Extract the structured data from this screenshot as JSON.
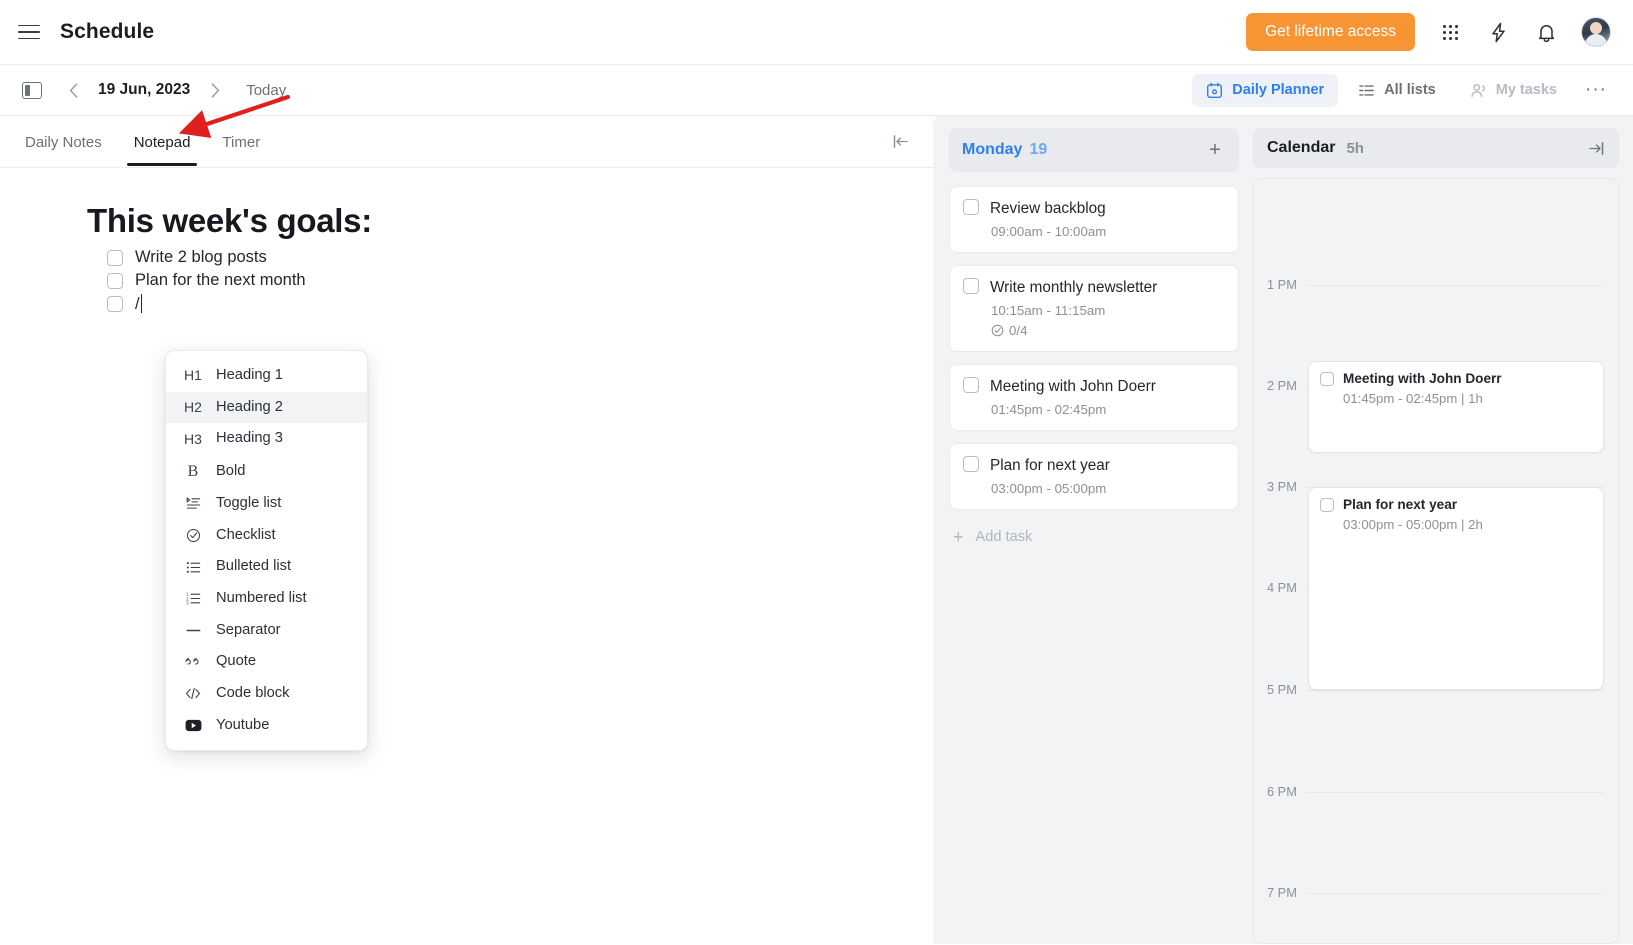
{
  "topbar": {
    "menu_icon": "hamburger-icon",
    "app_title": "Schedule",
    "cta_label": "Get lifetime access",
    "cta_color": "#F79433",
    "icons": [
      "apps-grid-icon",
      "lightning-icon",
      "bell-icon",
      "avatar"
    ]
  },
  "subbar": {
    "panel_toggle_icon": "sidebar-toggle-icon",
    "prev_icon": "chevron-left-icon",
    "next_icon": "chevron-right-icon",
    "date": "19 Jun, 2023",
    "today_label": "Today",
    "views": [
      {
        "label": "Daily Planner",
        "icon": "calendar-icon",
        "active": true,
        "muted": false
      },
      {
        "label": "All lists",
        "icon": "list-icon",
        "active": false,
        "muted": false
      },
      {
        "label": "My tasks",
        "icon": "people-icon",
        "active": false,
        "muted": true
      }
    ],
    "more_label": "···",
    "accent_color": "#2B7FF2"
  },
  "notes": {
    "tabs": [
      {
        "label": "Daily Notes",
        "active": false
      },
      {
        "label": "Notepad",
        "active": true
      },
      {
        "label": "Timer",
        "active": false
      }
    ],
    "collapse_icon": "collapse-left-icon",
    "heading": "This week's goals:",
    "items": [
      {
        "text": "Write 2 blog posts",
        "checked": false,
        "caret": false
      },
      {
        "text": "Plan for the next month",
        "checked": false,
        "caret": false
      },
      {
        "text": "/",
        "checked": false,
        "caret": true
      }
    ]
  },
  "slash_menu": {
    "items": [
      {
        "glyph": "H1",
        "label": "Heading 1",
        "icon": "heading-1-icon",
        "selected": false
      },
      {
        "glyph": "H2",
        "label": "Heading 2",
        "icon": "heading-2-icon",
        "selected": true
      },
      {
        "glyph": "H3",
        "label": "Heading 3",
        "icon": "heading-3-icon",
        "selected": false
      },
      {
        "glyph": "B",
        "label": "Bold",
        "icon": "bold-icon",
        "selected": false
      },
      {
        "glyph": "",
        "label": "Toggle list",
        "icon": "toggle-list-icon",
        "selected": false
      },
      {
        "glyph": "",
        "label": "Checklist",
        "icon": "checklist-icon",
        "selected": false
      },
      {
        "glyph": "",
        "label": "Bulleted list",
        "icon": "bulleted-list-icon",
        "selected": false
      },
      {
        "glyph": "",
        "label": "Numbered list",
        "icon": "numbered-list-icon",
        "selected": false
      },
      {
        "glyph": "",
        "label": "Separator",
        "icon": "separator-icon",
        "selected": false
      },
      {
        "glyph": "",
        "label": "Quote",
        "icon": "quote-icon",
        "selected": false
      },
      {
        "glyph": "",
        "label": "Code block",
        "icon": "code-block-icon",
        "selected": false
      },
      {
        "glyph": "",
        "label": "Youtube",
        "icon": "youtube-icon",
        "selected": false
      }
    ]
  },
  "tasks": {
    "day_name": "Monday",
    "day_number": "19",
    "add_icon": "plus-icon",
    "add_task_label": "Add task",
    "list": [
      {
        "title": "Review backblog",
        "time": "09:00am - 10:00am",
        "subtasks": null,
        "checked": false
      },
      {
        "title": "Write monthly newsletter",
        "time": "10:15am - 11:15am",
        "subtasks": "0/4",
        "checked": false
      },
      {
        "title": "Meeting with John Doerr",
        "time": "01:45pm - 02:45pm",
        "subtasks": null,
        "checked": false
      },
      {
        "title": "Plan for next year",
        "time": "03:00pm - 05:00pm",
        "subtasks": null,
        "checked": false
      }
    ]
  },
  "calendar": {
    "title": "Calendar",
    "duration": "5h",
    "collapse_icon": "collapse-right-icon",
    "hours": [
      "1 PM",
      "2 PM",
      "3 PM",
      "4 PM",
      "5 PM",
      "6 PM",
      "7 PM"
    ],
    "events": [
      {
        "title": "Meeting with John Doerr",
        "time": "01:45pm - 02:45pm | 1h",
        "checked": false
      },
      {
        "title": "Plan for next year",
        "time": "03:00pm - 05:00pm | 2h",
        "checked": false
      }
    ]
  },
  "annotation": {
    "arrow_color": "#E02020"
  }
}
